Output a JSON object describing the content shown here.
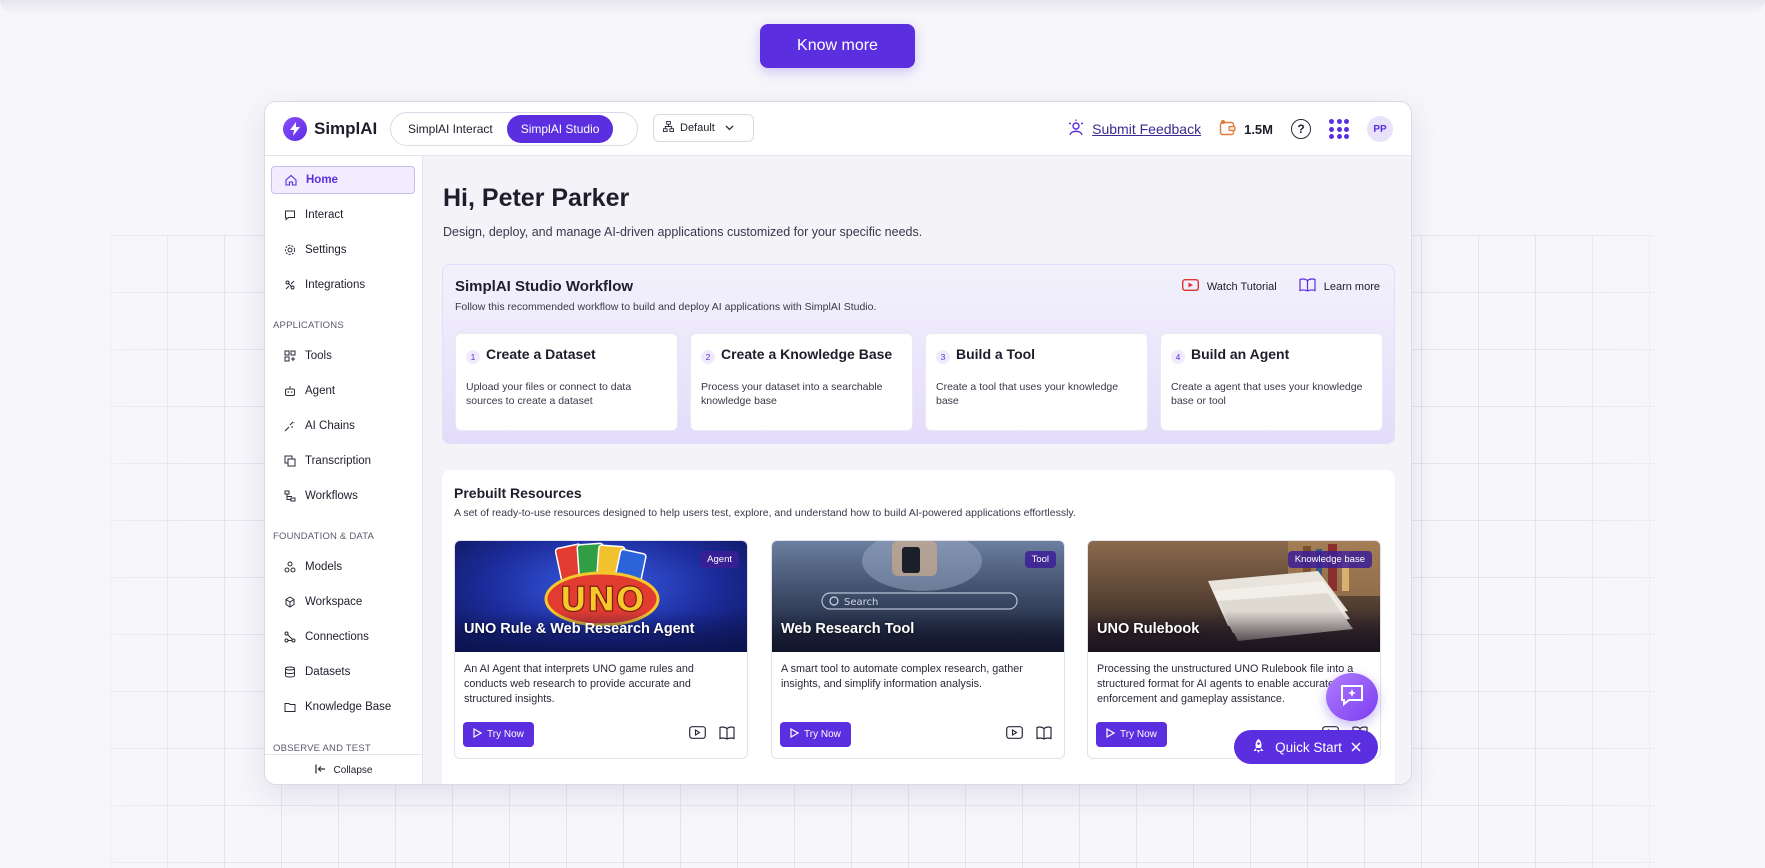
{
  "banner": {
    "know_more_label": "Know more"
  },
  "app": {
    "logo_text": "SimplAI",
    "modes": [
      "SimplAI Interact",
      "SimplAI Studio"
    ],
    "active_mode": "SimplAI Studio",
    "workspace": "Default",
    "feedback_label": "Submit Feedback",
    "credits": "1.5M",
    "help_glyph": "?",
    "avatar_initials": "PP"
  },
  "sidebar": {
    "items_top": [
      {
        "label": "Home",
        "icon": "home-icon",
        "active": true
      },
      {
        "label": "Interact",
        "icon": "chat-bubble-icon"
      },
      {
        "label": "Settings",
        "icon": "gear-icon"
      },
      {
        "label": "Integrations",
        "icon": "integrations-icon"
      }
    ],
    "section_applications": "APPLICATIONS",
    "items_applications": [
      {
        "label": "Tools",
        "icon": "tools-icon"
      },
      {
        "label": "Agent",
        "icon": "agent-icon"
      },
      {
        "label": "AI Chains",
        "icon": "ai-chains-icon"
      },
      {
        "label": "Transcription",
        "icon": "transcription-icon"
      },
      {
        "label": "Workflows",
        "icon": "workflows-icon"
      }
    ],
    "section_foundation": "FOUNDATION & DATA",
    "items_foundation": [
      {
        "label": "Models",
        "icon": "models-icon"
      },
      {
        "label": "Workspace",
        "icon": "workspace-icon"
      },
      {
        "label": "Connections",
        "icon": "connections-icon"
      },
      {
        "label": "Datasets",
        "icon": "datasets-icon"
      },
      {
        "label": "Knowledge Base",
        "icon": "knowledge-base-icon"
      }
    ],
    "section_observe": "OBSERVE AND TEST",
    "collapse_label": "Collapse"
  },
  "main": {
    "greeting": "Hi, Peter Parker",
    "subtitle": "Design, deploy, and manage AI-driven applications customized for your specific needs.",
    "workflow": {
      "title": "SimplAI Studio Workflow",
      "subtitle": "Follow this recommended workflow to build and deploy AI applications with SimplAI Studio.",
      "watch_tutorial": "Watch Tutorial",
      "learn_more": "Learn more",
      "steps": [
        {
          "num": "1",
          "title": "Create a Dataset",
          "desc": "Upload your files or connect to data sources to create a dataset"
        },
        {
          "num": "2",
          "title": "Create a Knowledge Base",
          "desc": "Process your dataset into a searchable knowledge base"
        },
        {
          "num": "3",
          "title": "Build a Tool",
          "desc": "Create a tool that uses your knowledge base"
        },
        {
          "num": "4",
          "title": "Build an Agent",
          "desc": "Create a agent that uses your knowledge base or tool"
        }
      ]
    },
    "prebuilt": {
      "title": "Prebuilt Resources",
      "subtitle": "A set of ready-to-use resources designed to help users test, explore, and understand how to build AI-powered applications effortlessly.",
      "try_label": "Try Now",
      "cards": [
        {
          "badge": "Agent",
          "title": "UNO Rule & Web Research Agent",
          "desc": "An AI Agent that interprets UNO game rules and conducts web research to provide accurate and structured insights."
        },
        {
          "badge": "Tool",
          "title": "Web Research Tool",
          "desc": "A smart tool to automate complex research, gather insights, and simplify information analysis."
        },
        {
          "badge": "Knowledge base",
          "title": "UNO Rulebook",
          "desc": "Processing the unstructured UNO Rulebook file into a structured format for AI agents to enable accurate rule enforcement and gameplay assistance."
        }
      ],
      "search_image_text": "Search"
    }
  },
  "floating": {
    "quick_start_label": "Quick Start"
  },
  "colors": {
    "accent": "#5b2ee0",
    "accent_light": "#efebfc",
    "background": "#f7f6fa"
  }
}
